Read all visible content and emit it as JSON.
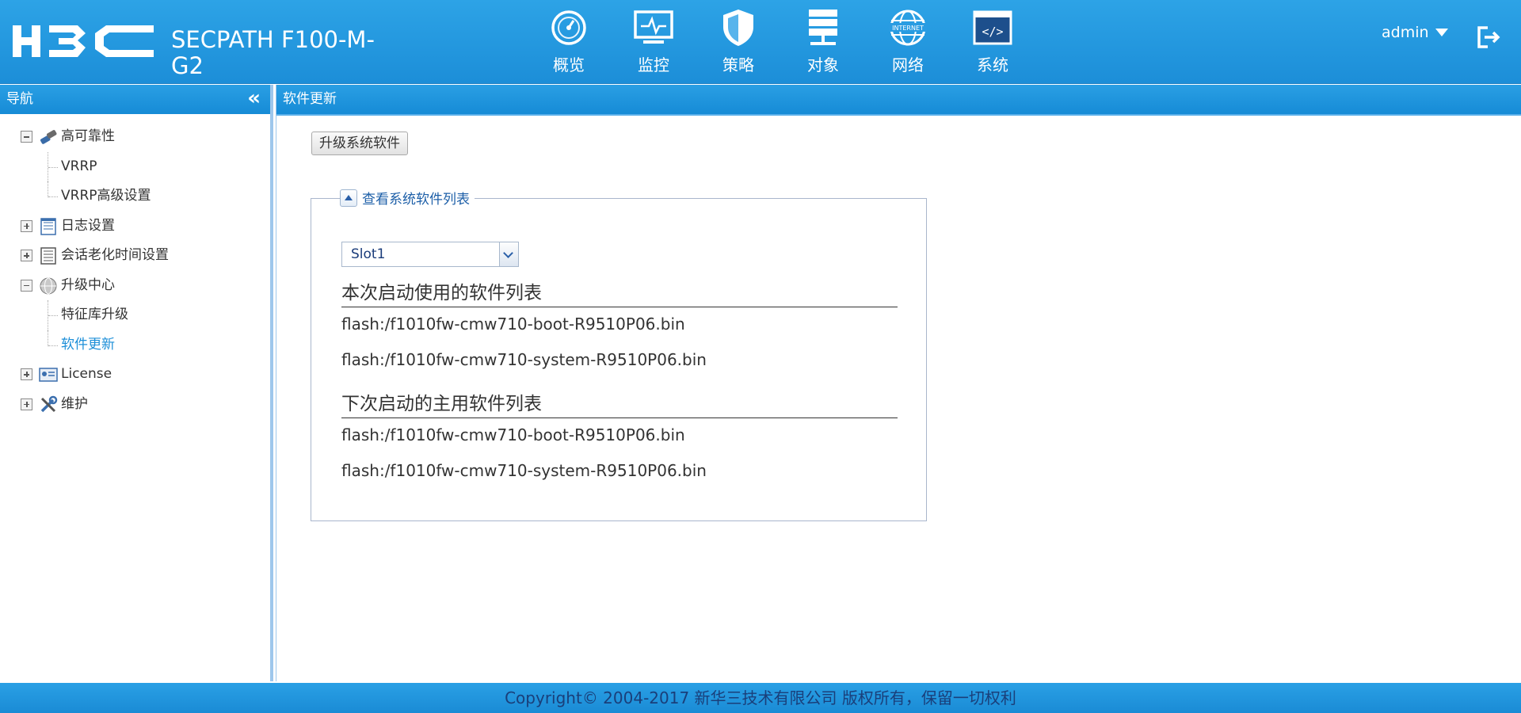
{
  "header": {
    "logo_text": "H3C",
    "product": "SECPATH F100-M-G2",
    "nav": [
      {
        "label": "概览",
        "icon": "gauge-icon"
      },
      {
        "label": "监控",
        "icon": "monitor-icon"
      },
      {
        "label": "策略",
        "icon": "shield-icon"
      },
      {
        "label": "对象",
        "icon": "server-stack-icon"
      },
      {
        "label": "网络",
        "icon": "internet-globe-icon"
      },
      {
        "label": "系统",
        "icon": "code-window-icon"
      }
    ],
    "user": "admin"
  },
  "sidebar": {
    "title": "导航",
    "tree": [
      {
        "label": "高可靠性",
        "expanded": true,
        "icon": "link-icon",
        "children": [
          "VRRP",
          "VRRP高级设置"
        ]
      },
      {
        "label": "日志设置",
        "expanded": false,
        "icon": "log-icon"
      },
      {
        "label": "会话老化时间设置",
        "expanded": false,
        "icon": "list-icon"
      },
      {
        "label": "升级中心",
        "expanded": true,
        "icon": "globe-icon",
        "children": [
          "特征库升级",
          "软件更新"
        ]
      },
      {
        "label": "License",
        "expanded": false,
        "icon": "license-card-icon"
      },
      {
        "label": "维护",
        "expanded": false,
        "icon": "tools-icon"
      }
    ],
    "active_item": "软件更新"
  },
  "main": {
    "title": "软件更新",
    "upgrade_button": "升级系统软件",
    "fieldset_title": "查看系统软件列表",
    "slot_select": "Slot1",
    "current_title": "本次启动使用的软件列表",
    "current_files": [
      "flash:/f1010fw-cmw710-boot-R9510P06.bin",
      "flash:/f1010fw-cmw710-system-R9510P06.bin"
    ],
    "next_title": "下次启动的主用软件列表",
    "next_files": [
      "flash:/f1010fw-cmw710-boot-R9510P06.bin",
      "flash:/f1010fw-cmw710-system-R9510P06.bin"
    ]
  },
  "footer": {
    "copyright": "Copyright© 2004-2017 新华三技术有限公司 版权所有，保留一切权利"
  },
  "colors": {
    "header_blue": "#1c8ed8",
    "active_link": "#1d8fd8",
    "footer_text": "#1a3f7a"
  }
}
